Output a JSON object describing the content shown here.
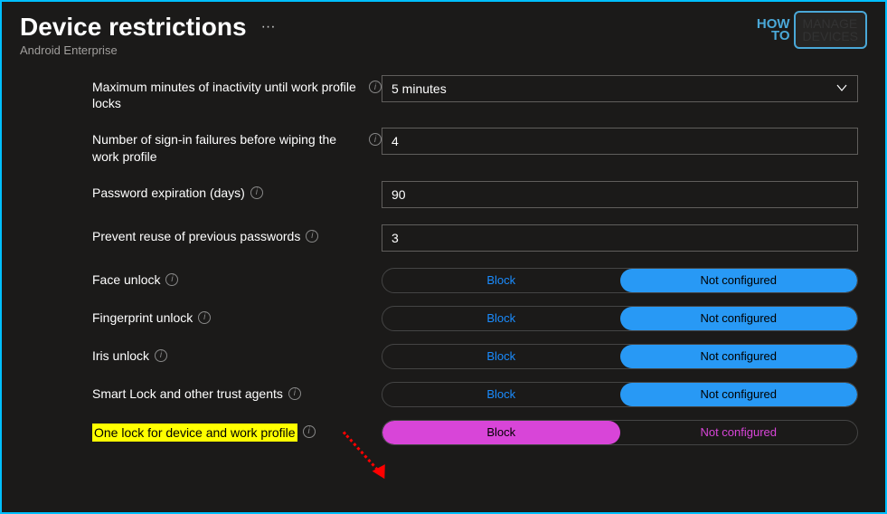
{
  "header": {
    "title": "Device restrictions",
    "subtitle": "Android Enterprise",
    "ellipsis": "···"
  },
  "logo": {
    "topLeft": "HOW",
    "bottomLeft": "TO",
    "topRight": "MANAGE",
    "bottomRight": "DEVICES"
  },
  "settings": {
    "maxMinutes": {
      "label": "Maximum minutes of inactivity until work profile locks",
      "value": "5 minutes"
    },
    "signinFailures": {
      "label": "Number of sign-in failures before wiping the work profile",
      "value": "4"
    },
    "passwordExpiration": {
      "label": "Password expiration (days)",
      "value": "90"
    },
    "preventReuse": {
      "label": "Prevent reuse of previous passwords",
      "value": "3"
    },
    "faceUnlock": {
      "label": "Face unlock",
      "block": "Block",
      "notConfigured": "Not configured"
    },
    "fingerprintUnlock": {
      "label": "Fingerprint unlock",
      "block": "Block",
      "notConfigured": "Not configured"
    },
    "irisUnlock": {
      "label": "Iris unlock",
      "block": "Block",
      "notConfigured": "Not configured"
    },
    "smartLock": {
      "label": "Smart Lock and other trust agents",
      "block": "Block",
      "notConfigured": "Not configured"
    },
    "oneLock": {
      "label": "One lock for device and work profile",
      "block": "Block",
      "notConfigured": "Not configured"
    }
  },
  "infoGlyph": "i"
}
